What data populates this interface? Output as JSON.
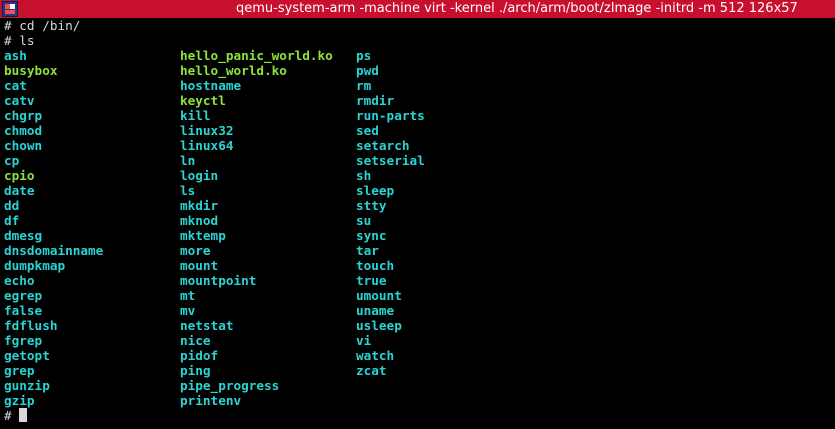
{
  "window": {
    "title": "qemu-system-arm -machine virt -kernel ./arch/arm/boot/zImage -initrd   -m 512 126x57"
  },
  "colors": {
    "titlebar_bg": "#c8102e",
    "link_text": "#2bd4d4",
    "exec_text": "#8ee23b",
    "prompt_text": "#d8d8d8"
  },
  "terminal": {
    "line1": "# cd /bin/",
    "line2": "# ls",
    "columns": [
      {
        "items": [
          {
            "name": "ash",
            "kind": "link"
          },
          {
            "name": "busybox",
            "kind": "exec"
          },
          {
            "name": "cat",
            "kind": "link"
          },
          {
            "name": "catv",
            "kind": "link"
          },
          {
            "name": "chgrp",
            "kind": "link"
          },
          {
            "name": "chmod",
            "kind": "link"
          },
          {
            "name": "chown",
            "kind": "link"
          },
          {
            "name": "cp",
            "kind": "link"
          },
          {
            "name": "cpio",
            "kind": "exec"
          },
          {
            "name": "date",
            "kind": "link"
          },
          {
            "name": "dd",
            "kind": "link"
          },
          {
            "name": "df",
            "kind": "link"
          },
          {
            "name": "dmesg",
            "kind": "link"
          },
          {
            "name": "dnsdomainname",
            "kind": "link"
          },
          {
            "name": "dumpkmap",
            "kind": "link"
          },
          {
            "name": "echo",
            "kind": "link"
          },
          {
            "name": "egrep",
            "kind": "link"
          },
          {
            "name": "false",
            "kind": "link"
          },
          {
            "name": "fdflush",
            "kind": "link"
          },
          {
            "name": "fgrep",
            "kind": "link"
          },
          {
            "name": "getopt",
            "kind": "link"
          },
          {
            "name": "grep",
            "kind": "link"
          },
          {
            "name": "gunzip",
            "kind": "link"
          },
          {
            "name": "gzip",
            "kind": "link"
          }
        ]
      },
      {
        "items": [
          {
            "name": "hello_panic_world.ko",
            "kind": "exec"
          },
          {
            "name": "hello_world.ko",
            "kind": "exec"
          },
          {
            "name": "hostname",
            "kind": "link"
          },
          {
            "name": "keyctl",
            "kind": "exec"
          },
          {
            "name": "kill",
            "kind": "link"
          },
          {
            "name": "linux32",
            "kind": "link"
          },
          {
            "name": "linux64",
            "kind": "link"
          },
          {
            "name": "ln",
            "kind": "link"
          },
          {
            "name": "login",
            "kind": "link"
          },
          {
            "name": "ls",
            "kind": "link"
          },
          {
            "name": "mkdir",
            "kind": "link"
          },
          {
            "name": "mknod",
            "kind": "link"
          },
          {
            "name": "mktemp",
            "kind": "link"
          },
          {
            "name": "more",
            "kind": "link"
          },
          {
            "name": "mount",
            "kind": "link"
          },
          {
            "name": "mountpoint",
            "kind": "link"
          },
          {
            "name": "mt",
            "kind": "link"
          },
          {
            "name": "mv",
            "kind": "link"
          },
          {
            "name": "netstat",
            "kind": "link"
          },
          {
            "name": "nice",
            "kind": "link"
          },
          {
            "name": "pidof",
            "kind": "link"
          },
          {
            "name": "ping",
            "kind": "link"
          },
          {
            "name": "pipe_progress",
            "kind": "link"
          },
          {
            "name": "printenv",
            "kind": "link"
          }
        ]
      },
      {
        "items": [
          {
            "name": "ps",
            "kind": "link"
          },
          {
            "name": "pwd",
            "kind": "link"
          },
          {
            "name": "rm",
            "kind": "link"
          },
          {
            "name": "rmdir",
            "kind": "link"
          },
          {
            "name": "run-parts",
            "kind": "link"
          },
          {
            "name": "sed",
            "kind": "link"
          },
          {
            "name": "setarch",
            "kind": "link"
          },
          {
            "name": "setserial",
            "kind": "link"
          },
          {
            "name": "sh",
            "kind": "link"
          },
          {
            "name": "sleep",
            "kind": "link"
          },
          {
            "name": "stty",
            "kind": "link"
          },
          {
            "name": "su",
            "kind": "link"
          },
          {
            "name": "sync",
            "kind": "link"
          },
          {
            "name": "tar",
            "kind": "link"
          },
          {
            "name": "touch",
            "kind": "link"
          },
          {
            "name": "true",
            "kind": "link"
          },
          {
            "name": "umount",
            "kind": "link"
          },
          {
            "name": "uname",
            "kind": "link"
          },
          {
            "name": "usleep",
            "kind": "link"
          },
          {
            "name": "vi",
            "kind": "link"
          },
          {
            "name": "watch",
            "kind": "link"
          },
          {
            "name": "zcat",
            "kind": "link"
          }
        ]
      }
    ],
    "final_prompt": "# "
  }
}
